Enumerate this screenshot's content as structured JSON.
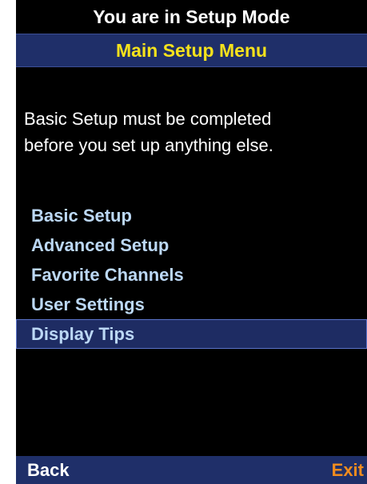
{
  "header": {
    "mode_text": "You are in Setup Mode",
    "menu_title": "Main Setup Menu"
  },
  "message": {
    "line1": "Basic Setup must be completed",
    "line2": "before you set up anything else."
  },
  "menu": {
    "items": [
      {
        "label": "Basic Setup"
      },
      {
        "label": "Advanced Setup"
      },
      {
        "label": "Favorite Channels"
      },
      {
        "label": "User Settings"
      },
      {
        "label": "Display Tips",
        "selected": true
      }
    ]
  },
  "softkeys": {
    "left_label": "Back",
    "right_label": "Exit"
  },
  "colors": {
    "background": "#000000",
    "title_bar": "#1f2f69",
    "title_text": "#f5e21c",
    "menu_text": "#bcd8f5",
    "selected_bg": "#1e2c63",
    "exit_text": "#f28c1e"
  }
}
